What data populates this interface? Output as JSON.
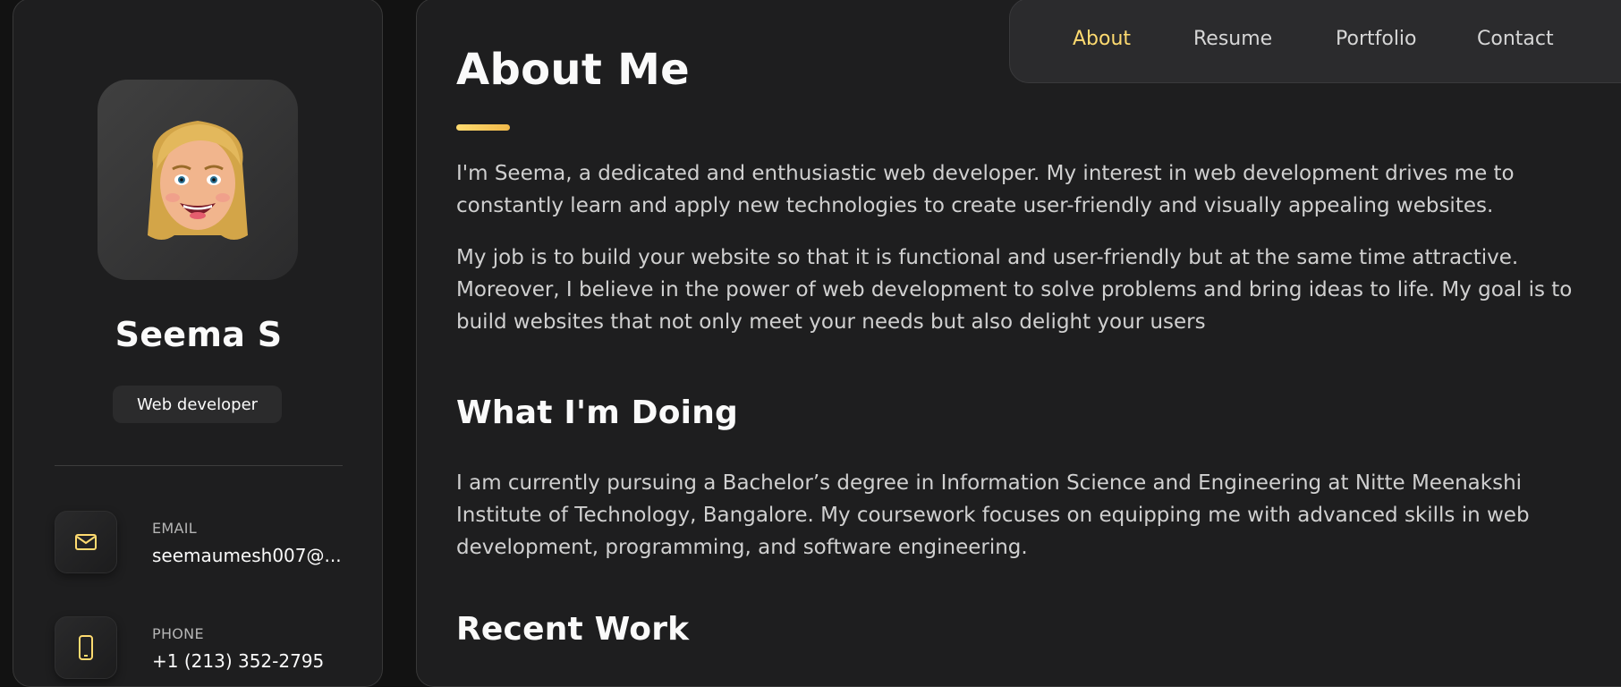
{
  "profile": {
    "name": "Seema S",
    "role": "Web developer"
  },
  "contacts": [
    {
      "label": "EMAIL",
      "value": "seemaumesh007@...",
      "icon": "mail-icon"
    },
    {
      "label": "PHONE",
      "value": "+1 (213) 352-2795",
      "icon": "phone-icon"
    }
  ],
  "nav": {
    "items": [
      "About",
      "Resume",
      "Portfolio",
      "Contact"
    ],
    "active": "About"
  },
  "about": {
    "title": "About Me",
    "paragraphs": [
      "I'm Seema, a dedicated and enthusiastic web developer. My interest in web development drives me to constantly learn and apply new technologies to create user-friendly and visually appealing websites.",
      "My job is to build your website so that it is functional and user-friendly but at the same time attractive. Moreover, I believe in the power of web development to solve problems and bring ideas to life. My goal is to build websites that not only meet your needs but also delight your users"
    ]
  },
  "doing": {
    "title": "What I'm Doing",
    "text": "I am currently pursuing a Bachelor’s degree in Information Science and Engineering at Nitte Meenakshi Institute of Technology, Bangalore. My coursework focuses on equipping me with advanced skills in web development, programming, and software engineering."
  },
  "recent": {
    "title": "Recent Work"
  },
  "colors": {
    "accent": "#ffdb70",
    "background": "#121212",
    "panel": "#1e1e1f"
  }
}
